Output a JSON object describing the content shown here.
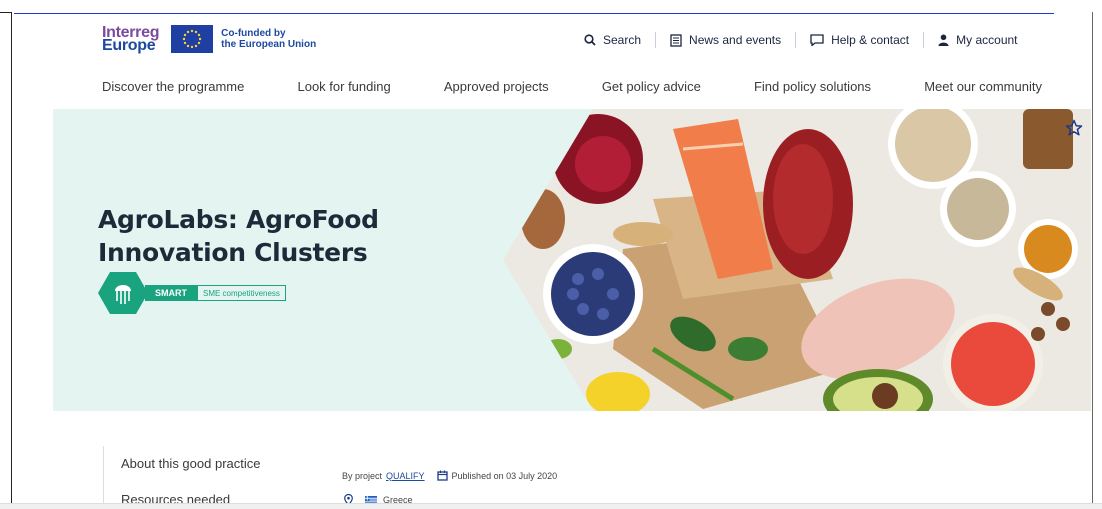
{
  "header": {
    "logo_line1": "Interreg",
    "logo_line2": "Europe",
    "eu_line1": "Co-funded by",
    "eu_line2": "the European Union"
  },
  "utility_nav": [
    {
      "label": "Search",
      "icon": "search-icon"
    },
    {
      "label": "News and events",
      "icon": "newspaper-icon"
    },
    {
      "label": "Help & contact",
      "icon": "chat-icon"
    },
    {
      "label": "My account",
      "icon": "user-icon"
    }
  ],
  "main_nav": [
    "Discover the programme",
    "Look for funding",
    "Approved projects",
    "Get policy advice",
    "Find policy solutions",
    "Meet our community"
  ],
  "hero": {
    "title_line1": "AgroLabs: AgroFood",
    "title_line2": "Innovation Clusters",
    "badge_primary": "SMART",
    "badge_secondary": "SME competitiveness"
  },
  "sidebar": {
    "items": [
      "About this good practice",
      "Resources needed"
    ]
  },
  "meta": {
    "by_project_prefix": "By project",
    "project_name": "QUALIFY",
    "published": "Published on 03 July 2020",
    "country": "Greece"
  },
  "colors": {
    "accent_green": "#1aa37f",
    "hero_bg": "#e4f5f1",
    "brand_blue": "#1d4aa0",
    "brand_purple": "#7a4b9c"
  }
}
